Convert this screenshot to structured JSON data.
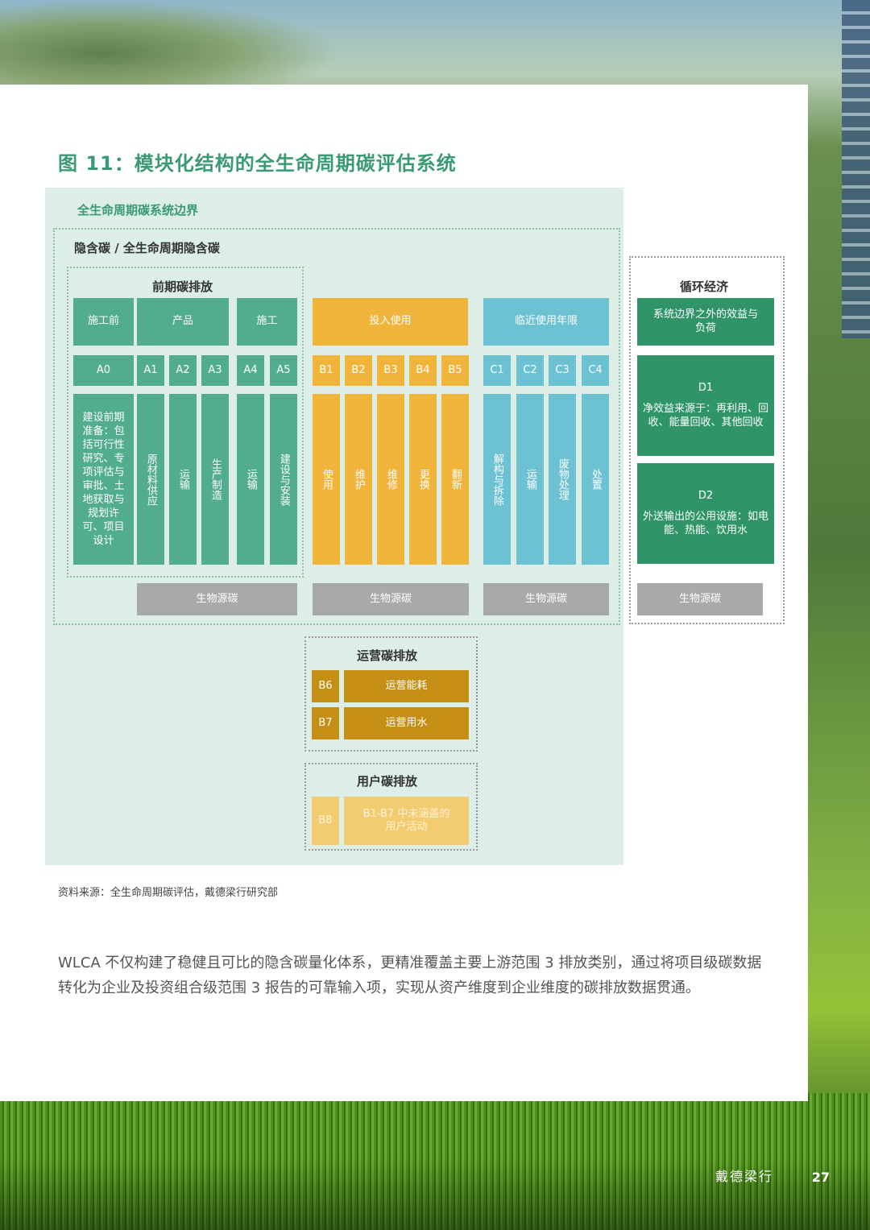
{
  "figure_title": "图 11：模块化结构的全生命周期碳评估系统",
  "boundary_label": "全生命周期碳系统边界",
  "embodied_label": "隐含碳 / 全生命周期隐含碳",
  "upfront_label": "前期碳排放",
  "stages": {
    "pre_construction": "施工前",
    "product": "产品",
    "construction": "施工",
    "in_use": "投入使用",
    "end_of_life": "临近使用年限"
  },
  "modules": {
    "A0": "A0",
    "A1": "A1",
    "A2": "A2",
    "A3": "A3",
    "A4": "A4",
    "A5": "A5",
    "B1": "B1",
    "B2": "B2",
    "B3": "B3",
    "B4": "B4",
    "B5": "B5",
    "C1": "C1",
    "C2": "C2",
    "C3": "C3",
    "C4": "C4",
    "B6": "B6",
    "B7": "B7",
    "B8": "B8"
  },
  "descriptions": {
    "A0": "建设前期准备：包括可行性研究、专项评估与审批、土地获取与规划许可、项目设计",
    "A1": "原材料供应",
    "A2": "运输",
    "A3": "生产制造",
    "A4": "运输",
    "A5": "建设与安装",
    "B1": "使用",
    "B2": "维护",
    "B3": "维修",
    "B4": "更换",
    "B5": "翻新",
    "C1": "解构与拆除",
    "C2": "运输",
    "C3": "废物处理",
    "C4": "处置"
  },
  "biogenic": "生物源碳",
  "circular": {
    "title": "循环经济",
    "header": "系统边界之外的效益与负荷",
    "d1_code": "D1",
    "d1_text": "净效益来源于：再利用、回收、能量回收、其他回收",
    "d2_code": "D2",
    "d2_text": "外送输出的公用设施：如电能、热能、饮用水"
  },
  "operational": {
    "title": "运营碳排放",
    "b6": "运营能耗",
    "b7": "运营用水"
  },
  "user": {
    "title": "用户碳排放",
    "b8": "B1-B7 中未涵盖的用户活动"
  },
  "source": "资料来源：全生命周期碳评估，戴德梁行研究部",
  "paragraph": "WLCA 不仅构建了稳健且可比的隐含碳量化体系，更精准覆盖主要上游范围 3 排放类别，通过将项目级碳数据转化为企业及投资组合级范围 3 报告的可靠输入项，实现从资产维度到企业维度的碳排放数据贯通。",
  "footer_brand": "戴德梁行",
  "page_number": "27",
  "colors": {
    "title_green": "#3a9a72",
    "upfront_green": "#52ad8c",
    "circular_green": "#2f9569",
    "use_yellow": "#f1b43a",
    "eol_blue": "#6cc2d3",
    "biogenic_gray": "#a7a9ab",
    "operational_ochre": "#c48f14",
    "user_yellow": "#f3cc72"
  }
}
